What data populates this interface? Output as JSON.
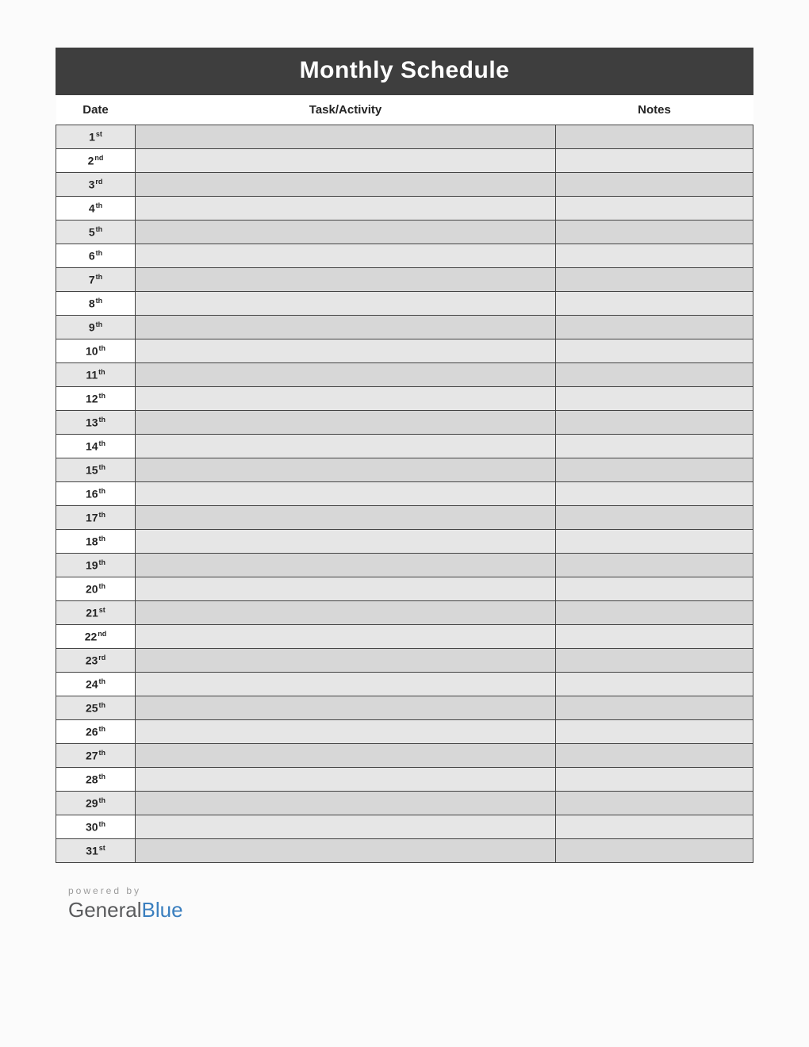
{
  "title": "Monthly Schedule",
  "columns": {
    "date": "Date",
    "task": "Task/Activity",
    "notes": "Notes"
  },
  "rows": [
    {
      "num": "1",
      "suf": "st",
      "task": "",
      "notes": ""
    },
    {
      "num": "2",
      "suf": "nd",
      "task": "",
      "notes": ""
    },
    {
      "num": "3",
      "suf": "rd",
      "task": "",
      "notes": ""
    },
    {
      "num": "4",
      "suf": "th",
      "task": "",
      "notes": ""
    },
    {
      "num": "5",
      "suf": "th",
      "task": "",
      "notes": ""
    },
    {
      "num": "6",
      "suf": "th",
      "task": "",
      "notes": ""
    },
    {
      "num": "7",
      "suf": "th",
      "task": "",
      "notes": ""
    },
    {
      "num": "8",
      "suf": "th",
      "task": "",
      "notes": ""
    },
    {
      "num": "9",
      "suf": "th",
      "task": "",
      "notes": ""
    },
    {
      "num": "10",
      "suf": "th",
      "task": "",
      "notes": ""
    },
    {
      "num": "11",
      "suf": "th",
      "task": "",
      "notes": ""
    },
    {
      "num": "12",
      "suf": "th",
      "task": "",
      "notes": ""
    },
    {
      "num": "13",
      "suf": "th",
      "task": "",
      "notes": ""
    },
    {
      "num": "14",
      "suf": "th",
      "task": "",
      "notes": ""
    },
    {
      "num": "15",
      "suf": "th",
      "task": "",
      "notes": ""
    },
    {
      "num": "16",
      "suf": "th",
      "task": "",
      "notes": ""
    },
    {
      "num": "17",
      "suf": "th",
      "task": "",
      "notes": ""
    },
    {
      "num": "18",
      "suf": "th",
      "task": "",
      "notes": ""
    },
    {
      "num": "19",
      "suf": "th",
      "task": "",
      "notes": ""
    },
    {
      "num": "20",
      "suf": "th",
      "task": "",
      "notes": ""
    },
    {
      "num": "21",
      "suf": "st",
      "task": "",
      "notes": ""
    },
    {
      "num": "22",
      "suf": "nd",
      "task": "",
      "notes": ""
    },
    {
      "num": "23",
      "suf": "rd",
      "task": "",
      "notes": ""
    },
    {
      "num": "24",
      "suf": "th",
      "task": "",
      "notes": ""
    },
    {
      "num": "25",
      "suf": "th",
      "task": "",
      "notes": ""
    },
    {
      "num": "26",
      "suf": "th",
      "task": "",
      "notes": ""
    },
    {
      "num": "27",
      "suf": "th",
      "task": "",
      "notes": ""
    },
    {
      "num": "28",
      "suf": "th",
      "task": "",
      "notes": ""
    },
    {
      "num": "29",
      "suf": "th",
      "task": "",
      "notes": ""
    },
    {
      "num": "30",
      "suf": "th",
      "task": "",
      "notes": ""
    },
    {
      "num": "31",
      "suf": "st",
      "task": "",
      "notes": ""
    }
  ],
  "footer": {
    "powered": "powered by",
    "brand1": "General",
    "brand2": "Blue"
  }
}
